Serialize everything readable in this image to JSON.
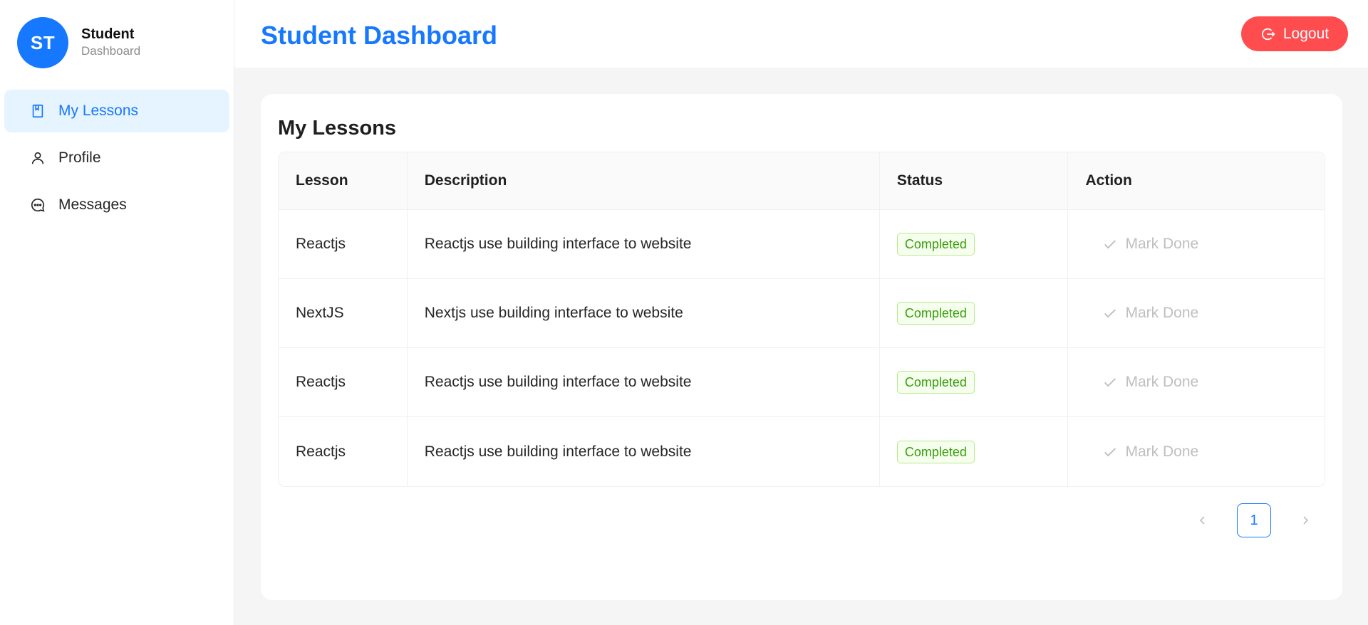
{
  "sidebar": {
    "avatar_initials": "ST",
    "brand_name": "Student",
    "brand_sub": "Dashboard",
    "items": [
      {
        "label": "My Lessons",
        "icon": "book-icon",
        "active": true
      },
      {
        "label": "Profile",
        "icon": "user-icon",
        "active": false
      },
      {
        "label": "Messages",
        "icon": "message-icon",
        "active": false
      }
    ]
  },
  "header": {
    "title": "Student Dashboard",
    "logout_label": "Logout"
  },
  "main": {
    "card_title": "My Lessons",
    "table": {
      "columns": [
        "Lesson",
        "Description",
        "Status",
        "Action"
      ],
      "rows": [
        {
          "lesson": "Reactjs",
          "description": "Reactjs use building interface to website",
          "status": "Completed",
          "action": "Mark Done"
        },
        {
          "lesson": "NextJS",
          "description": "Nextjs use building interface to website",
          "status": "Completed",
          "action": "Mark Done"
        },
        {
          "lesson": "Reactjs",
          "description": "Reactjs use building interface to website",
          "status": "Completed",
          "action": "Mark Done"
        },
        {
          "lesson": "Reactjs",
          "description": "Reactjs use building interface to website",
          "status": "Completed",
          "action": "Mark Done"
        }
      ]
    },
    "pagination": {
      "current_page": "1"
    }
  },
  "colors": {
    "primary": "#1677ff",
    "danger": "#ff4d4f",
    "success": "#389e0d",
    "disabled": "#bfbfbf"
  }
}
